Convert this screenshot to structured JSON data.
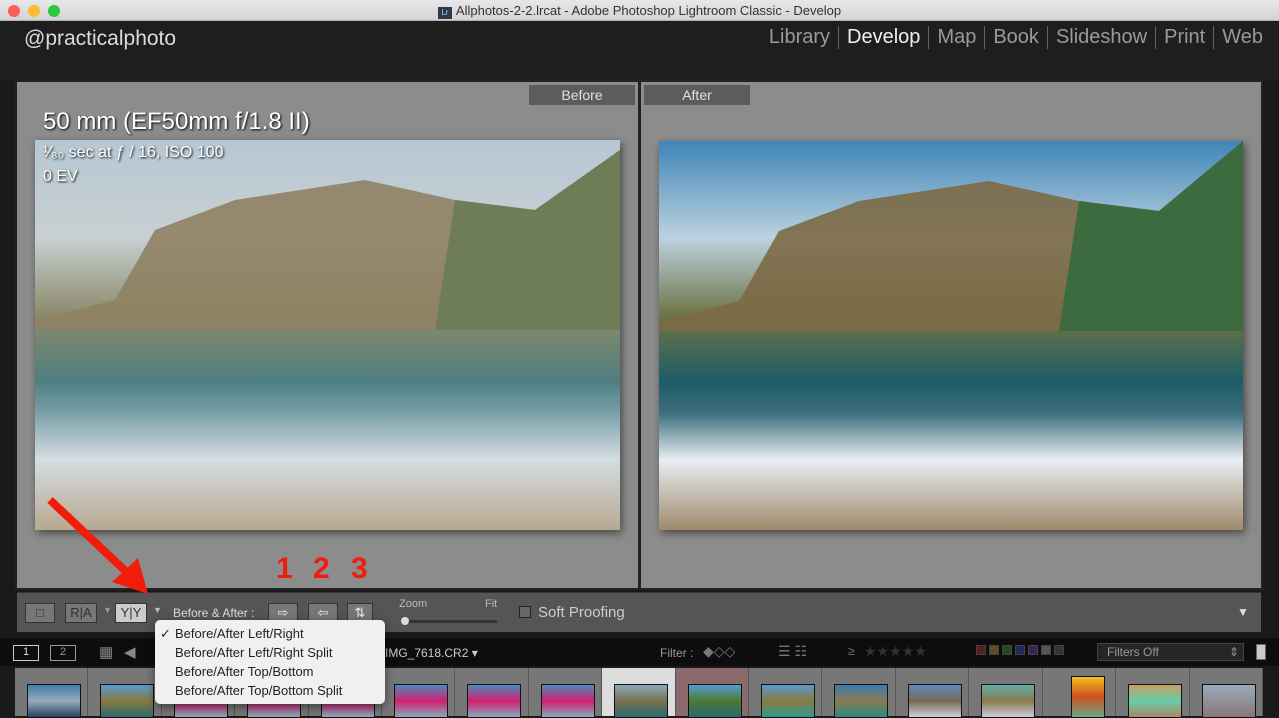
{
  "window": {
    "title": "Allphotos-2-2.lrcat - Adobe Photoshop Lightroom Classic - Develop",
    "app_icon": "Lr"
  },
  "identity_plate": "@practicalphoto",
  "modules": [
    {
      "label": "Library"
    },
    {
      "label": "Develop",
      "active": true
    },
    {
      "label": "Map"
    },
    {
      "label": "Book"
    },
    {
      "label": "Slideshow"
    },
    {
      "label": "Print"
    },
    {
      "label": "Web"
    }
  ],
  "before_pane": {
    "label": "Before",
    "lens": "50 mm (EF50mm f/1.8 II)",
    "exposure": "¹⁄₈₀ sec at ƒ / 16, ISO 100",
    "ev": "0 EV"
  },
  "after_pane": {
    "label": "After"
  },
  "toolbar": {
    "view_loupe": "□",
    "view_ra": "R|A",
    "view_yy": "Y|Y",
    "before_after_label": "Before & After :",
    "zoom_label": "Zoom",
    "zoom_fit": "Fit",
    "zoom_value": 0,
    "soft_proofing": "Soft Proofing",
    "soft_proofing_checked": false
  },
  "view_menu": {
    "items": [
      {
        "label": "Before/After Left/Right",
        "checked": true
      },
      {
        "label": "Before/After Left/Right Split"
      },
      {
        "label": "Before/After Top/Bottom"
      },
      {
        "label": "Before/After Top/Bottom Split"
      }
    ]
  },
  "annotations": {
    "numbers": [
      "1",
      "2",
      "3"
    ],
    "color": "#f21c0d"
  },
  "filmstrip": {
    "screen1": "1",
    "screen2": "2",
    "filename": "IMG_7618.CR2",
    "filter_label": "Filter :",
    "rating_op": "≥",
    "filters_value": "Filters Off"
  }
}
